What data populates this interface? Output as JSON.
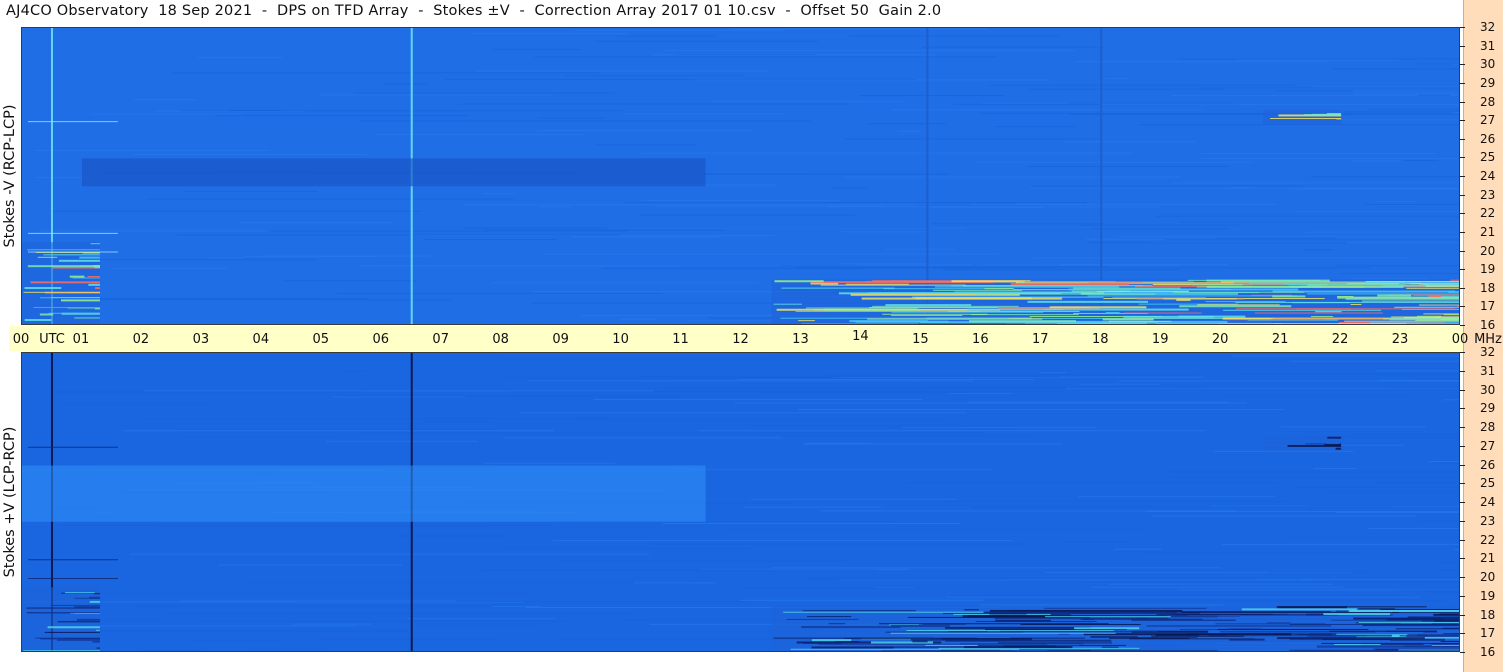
{
  "title": "AJ4CO Observatory  18 Sep 2021  -  DPS on TFD Array  -  Stokes ±V  -  Correction Array 2017 01 10.csv  -  Offset 50  Gain 2.0",
  "colors": {
    "time_strip": "#ffffc8",
    "freq_strip": "#ffddbb",
    "background_blue": "#1f6ee6"
  },
  "chart_data": [
    {
      "type": "heatmap",
      "panel": "top",
      "ylabel": "Stokes -V (RCP-LCP)",
      "x_unit": "UTC",
      "y_unit": "MHz",
      "xlim": [
        0,
        24
      ],
      "ylim": [
        16,
        32
      ],
      "x_ticks": [
        "00",
        "01",
        "02",
        "03",
        "04",
        "05",
        "06",
        "07",
        "08",
        "09",
        "10",
        "11",
        "12",
        "13",
        "14",
        "15",
        "16",
        "17",
        "18",
        "19",
        "20",
        "21",
        "22",
        "23",
        "00"
      ],
      "y_ticks": [
        "16",
        "17",
        "18",
        "19",
        "20",
        "21",
        "22",
        "23",
        "24",
        "25",
        "26",
        "27",
        "28",
        "29",
        "30",
        "31",
        "32"
      ],
      "colormap": "blue-cyan-yellow-red",
      "features": [
        {
          "kind": "vertical_line",
          "hour": 0.5,
          "color": "#62d6f0"
        },
        {
          "kind": "vertical_line",
          "hour": 6.5,
          "color": "#62d6f0"
        },
        {
          "kind": "vertical_line",
          "hour": 15.1,
          "color": "#1e5fcc"
        },
        {
          "kind": "vertical_line",
          "hour": 18.0,
          "color": "#1e5fcc"
        },
        {
          "kind": "darker_band",
          "hours": [
            1.0,
            11.4
          ],
          "mhz": [
            23.5,
            25.0
          ]
        },
        {
          "kind": "bright_band",
          "hours": [
            0.0,
            1.3
          ],
          "mhz": [
            16.0,
            20.5
          ]
        },
        {
          "kind": "bright_band",
          "hours": [
            12.5,
            24.0
          ],
          "mhz": [
            16.0,
            18.5
          ]
        },
        {
          "kind": "bright_band",
          "hours": [
            20.7,
            22.0
          ],
          "mhz": [
            26.8,
            27.6
          ]
        }
      ]
    },
    {
      "type": "heatmap",
      "panel": "bottom",
      "ylabel": "Stokes +V (LCP-RCP)",
      "x_unit": "UTC",
      "y_unit": "MHz",
      "xlim": [
        0,
        24
      ],
      "ylim": [
        16,
        32
      ],
      "x_ticks": [
        "00",
        "01",
        "02",
        "03",
        "04",
        "05",
        "06",
        "07",
        "08",
        "09",
        "10",
        "11",
        "12",
        "13",
        "14",
        "15",
        "16",
        "17",
        "18",
        "19",
        "20",
        "21",
        "22",
        "23",
        "00"
      ],
      "y_ticks": [
        "16",
        "17",
        "18",
        "19",
        "20",
        "21",
        "22",
        "23",
        "24",
        "25",
        "26",
        "27",
        "28",
        "29",
        "30",
        "31",
        "32"
      ],
      "colormap": "blue-cyan-yellow-red",
      "features": [
        {
          "kind": "vertical_line",
          "hour": 0.5,
          "color": "#0a1a50"
        },
        {
          "kind": "vertical_line",
          "hour": 6.5,
          "color": "#0a1a50"
        },
        {
          "kind": "lighter_band",
          "hours": [
            0.0,
            11.4
          ],
          "mhz": [
            23.0,
            26.0
          ]
        },
        {
          "kind": "dark_band",
          "hours": [
            0.0,
            1.3
          ],
          "mhz": [
            16.0,
            19.5
          ]
        },
        {
          "kind": "dark_band",
          "hours": [
            12.5,
            24.0
          ],
          "mhz": [
            16.0,
            18.5
          ]
        },
        {
          "kind": "dark_band",
          "hours": [
            20.7,
            22.0
          ],
          "mhz": [
            26.8,
            27.6
          ]
        }
      ]
    }
  ],
  "time_axis": {
    "unit_label": "UTC",
    "freq_unit_label": "MHz"
  }
}
